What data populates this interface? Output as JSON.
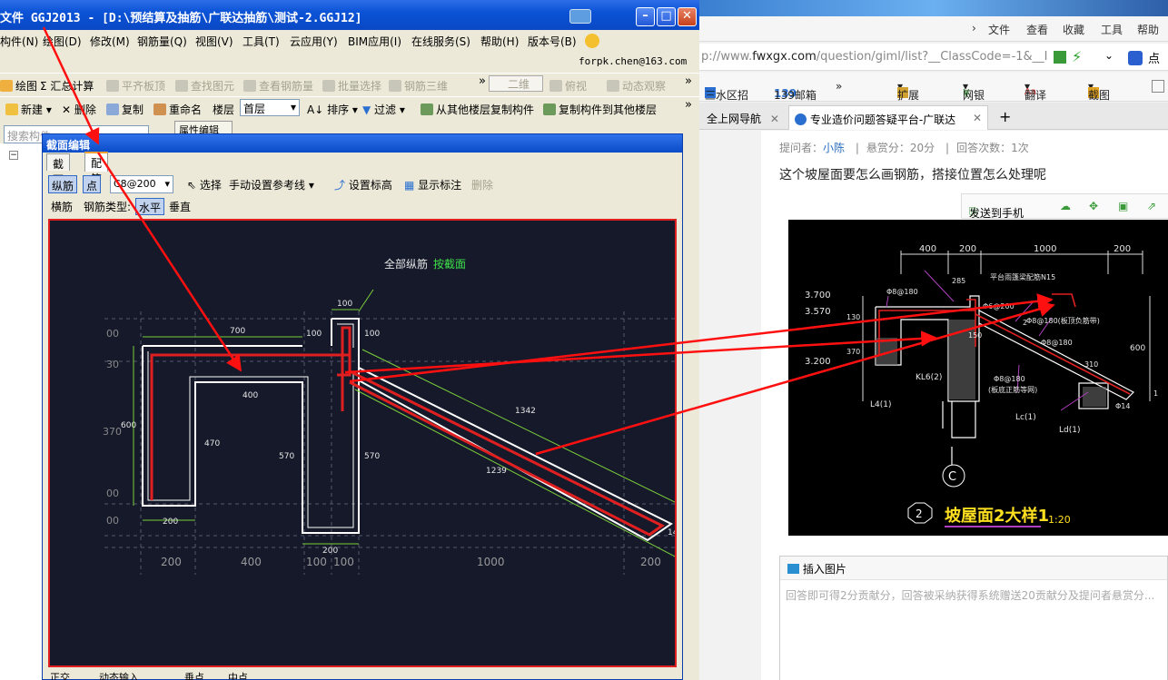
{
  "app": {
    "title": "文件 GGJ2013 - [D:\\预结算及抽筋\\广联达抽筋\\测试-2.GGJ12]",
    "menu": [
      "构件(N)",
      "绘图(D)",
      "修改(M)",
      "钢筋量(Q)",
      "视图(V)",
      "工具(T)",
      "云应用(Y)",
      "BIM应用(I)",
      "在线服务(S)",
      "帮助(H)",
      "版本号(B)"
    ],
    "email": "forpk.chen@163.com",
    "toolbar1": [
      "绘图",
      "汇总计算",
      "平齐板顶",
      "查找图元",
      "查看钢筋量",
      "批量选择",
      "钢筋三维",
      "二维",
      "俯视",
      "动态观察"
    ],
    "toolbar2": [
      "新建",
      "删除",
      "复制",
      "重命名",
      "楼层",
      "首层",
      "排序",
      "过滤",
      "从其他楼层复制构件",
      "复制构件到其他楼层"
    ],
    "search_placeholder": "搜索构件",
    "prop_tab": "属性编辑"
  },
  "dialog": {
    "title": "截面编辑",
    "tabs": [
      "截面",
      "配筋"
    ],
    "toolbar": {
      "longbar": "纵筋",
      "point": "点",
      "spec": "C8@200",
      "select": "选择",
      "ref_line": "手动设置参考线",
      "set_elev": "设置标高",
      "show_mark": "显示标注",
      "delete": "删除"
    },
    "toolbar2": {
      "stirrup": "横筋",
      "bar_type": "钢筋类型:",
      "horizontal": "水平",
      "vertical": "垂直"
    },
    "canvas": {
      "note_label": "全部纵筋",
      "note_value": "按截面",
      "dims": [
        "700",
        "100",
        "100",
        "100",
        "400",
        "600",
        "470",
        "570",
        "570",
        "200",
        "200",
        "1342",
        "1239",
        "00",
        "30",
        "370",
        "00",
        "00",
        "14"
      ],
      "bottom_dims": [
        "200",
        "400",
        "100",
        "100",
        "1000",
        "200"
      ]
    },
    "status": [
      "正交",
      "动态输入",
      "垂点",
      "中点"
    ]
  },
  "browser": {
    "menu": [
      "文件",
      "查看",
      "收藏",
      "工具",
      "帮助"
    ],
    "url_prefix": "p://www.",
    "url_domain": "fwxgx.com",
    "url_suffix": "/question/giml/list?__ClassCode=-1&__I",
    "url_right": "点",
    "bookmarks": [
      "三水区招",
      "139邮箱",
      "扩展",
      "网银",
      "翻译",
      "截图"
    ],
    "tabs": [
      "全上网导航",
      "专业造价问题答疑平台-广联达"
    ],
    "question": {
      "asker_label": "提问者：",
      "asker": "小陈",
      "reward": "悬赏分：20分",
      "answers": "回答次数：1次",
      "text": "这个坡屋面要怎么画钢筋，搭接位置怎么处理呢"
    },
    "send_label": "发送到手机",
    "cad": {
      "dims_top": [
        "400",
        "200",
        "1000",
        "200"
      ],
      "levels": [
        "3.700",
        "3.570",
        "3.200"
      ],
      "labels": [
        "平台雨篷梁配筋N15",
        "Φ8@180",
        "285",
        "Φ6@200",
        "Φ8@180(板顶负筋带)",
        "Φ8@180",
        "KL6(2)",
        "Φ8@180",
        "(板底正筋等网)",
        "L4(1)",
        "Lc(1)",
        "Ld(1)",
        "130",
        "370",
        "150",
        "600",
        "310",
        "2",
        "Φ14",
        "1"
      ],
      "axis": "C",
      "detail_no": "2",
      "detail_title": "坡屋面2大样1",
      "scale": "1:20"
    },
    "answer": {
      "insert_image": "插入图片",
      "placeholder": "回答即可得2分贡献分，回答被采纳获得系统赠送20贡献分及提问者悬赏分..."
    }
  },
  "colors": {
    "canvas_bg": "#15192a",
    "rebar": "#e02020",
    "dim": "#7ccf3a",
    "arrow": "#ff1010"
  }
}
